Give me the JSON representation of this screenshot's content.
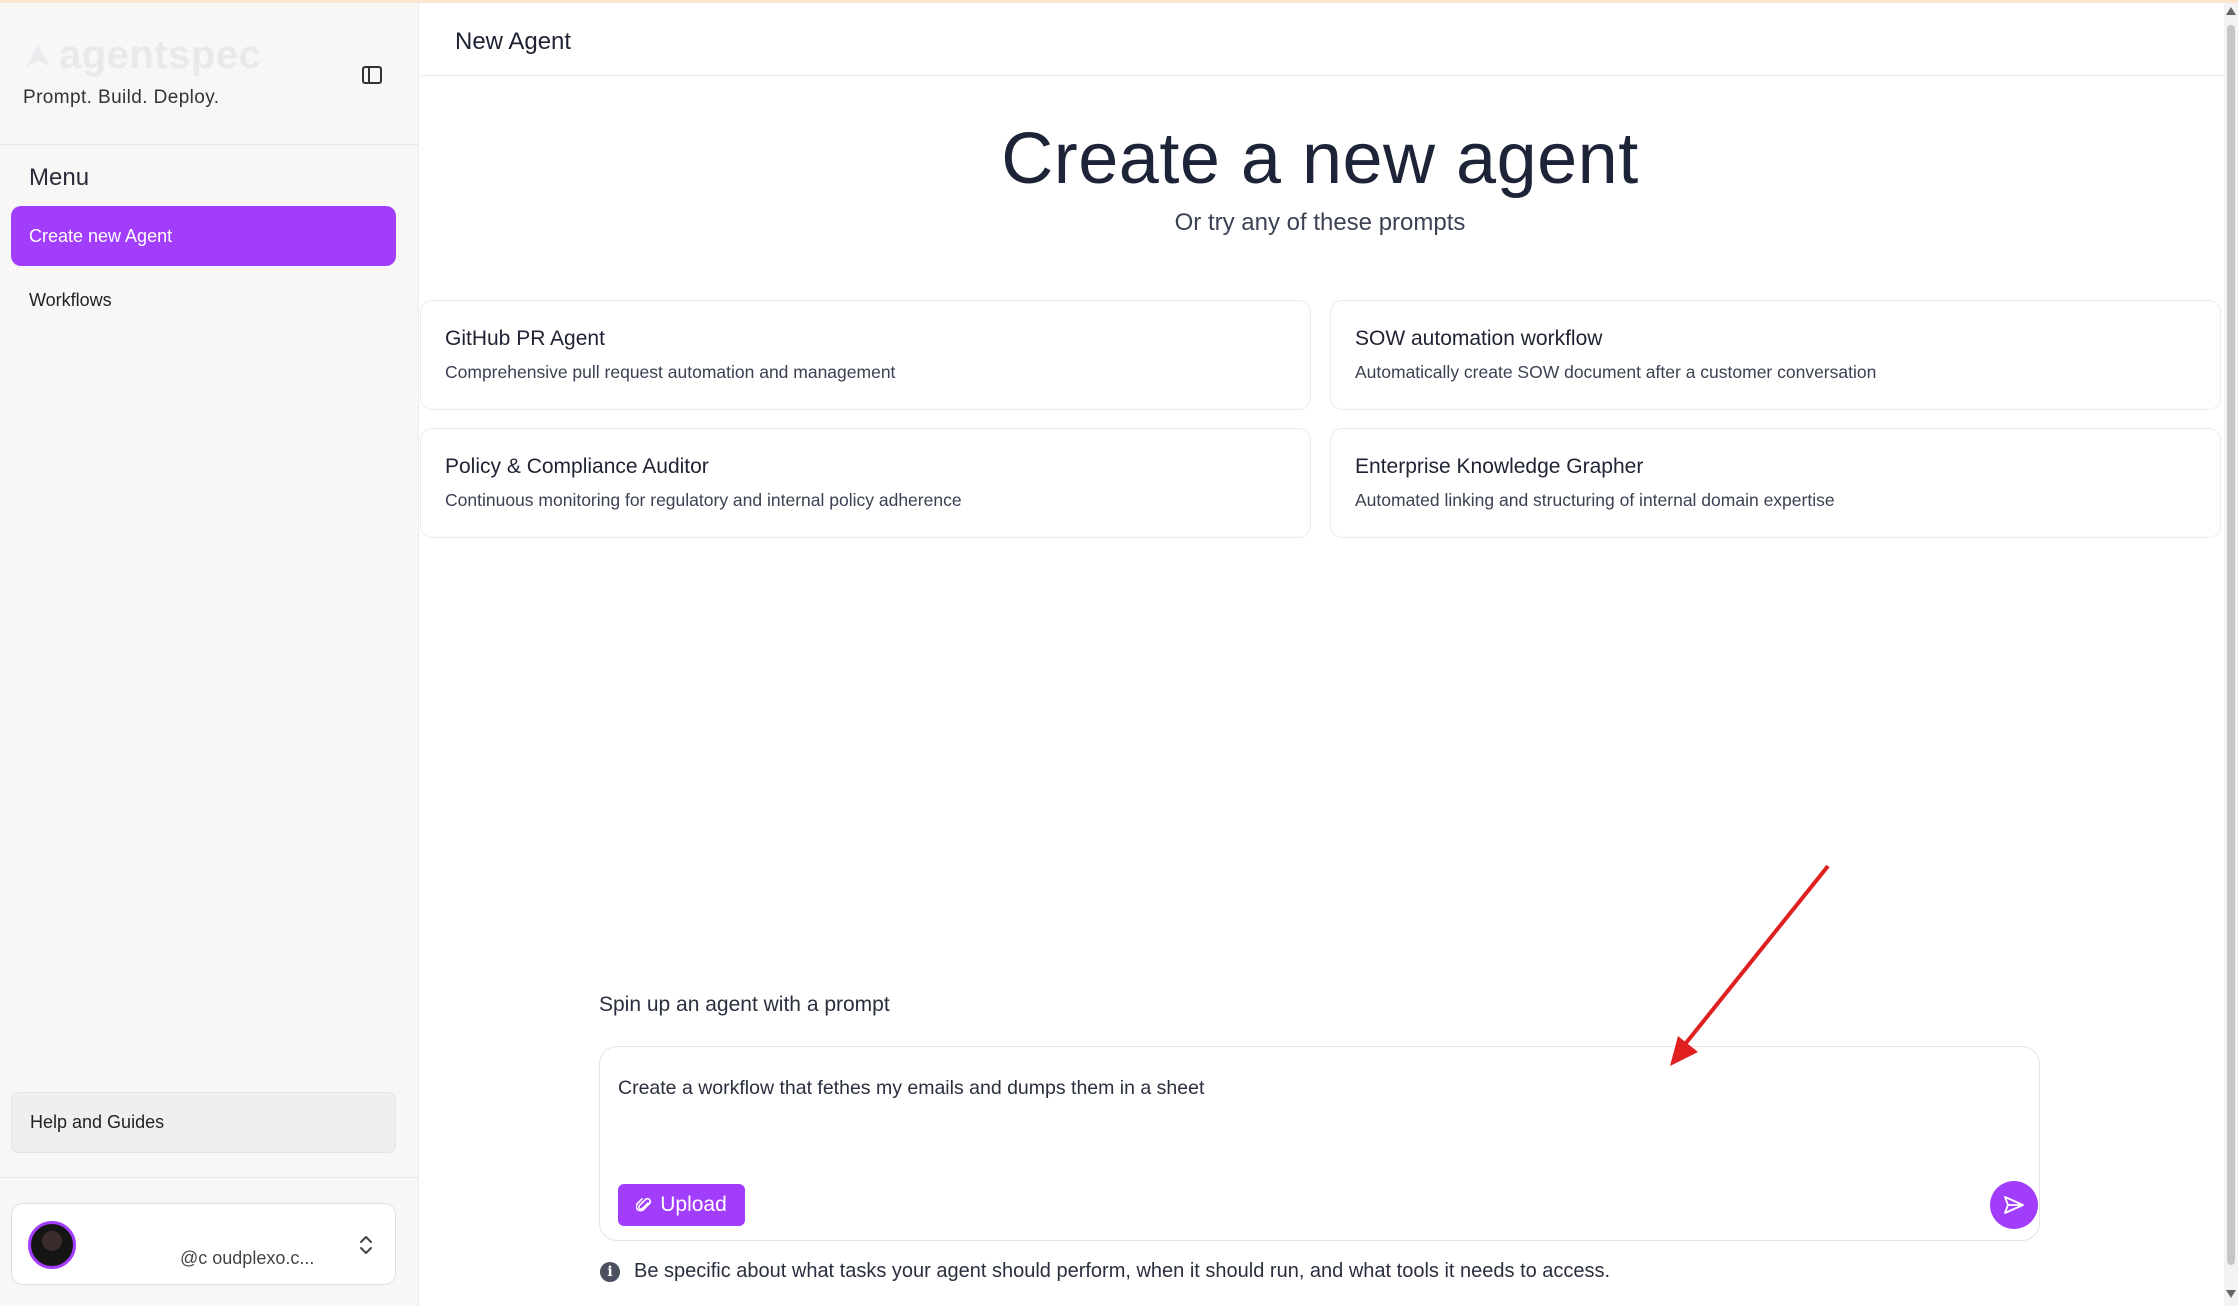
{
  "colors": {
    "accent": "#a33dfc",
    "annotation": "#e02020"
  },
  "sidebar": {
    "brand": "agentspec",
    "tagline": "Prompt. Build. Deploy.",
    "menu_label": "Menu",
    "items": [
      {
        "label": "Create new Agent",
        "active": true
      },
      {
        "label": "Workflows",
        "active": false
      }
    ],
    "help": "Help and Guides",
    "user": {
      "email": "@c oudplexo.c..."
    }
  },
  "header": {
    "title": "New Agent"
  },
  "hero": {
    "title": "Create a new agent",
    "subtitle": "Or try any of these prompts"
  },
  "cards": [
    {
      "title": "GitHub PR Agent",
      "desc": "Comprehensive pull request automation and management"
    },
    {
      "title": "SOW automation workflow",
      "desc": "Automatically create SOW document after a customer conversation"
    },
    {
      "title": "Policy & Compliance Auditor",
      "desc": "Continuous monitoring for regulatory and internal policy adherence"
    },
    {
      "title": "Enterprise Knowledge Grapher",
      "desc": "Automated linking and structuring of internal domain expertise"
    }
  ],
  "prompt": {
    "label": "Spin up an agent with a prompt",
    "value": "Create a workflow that fethes my emails and dumps them in a sheet",
    "upload_label": "Upload",
    "hint": "Be specific about what tasks your agent should perform, when it should run, and what tools it needs to access."
  }
}
